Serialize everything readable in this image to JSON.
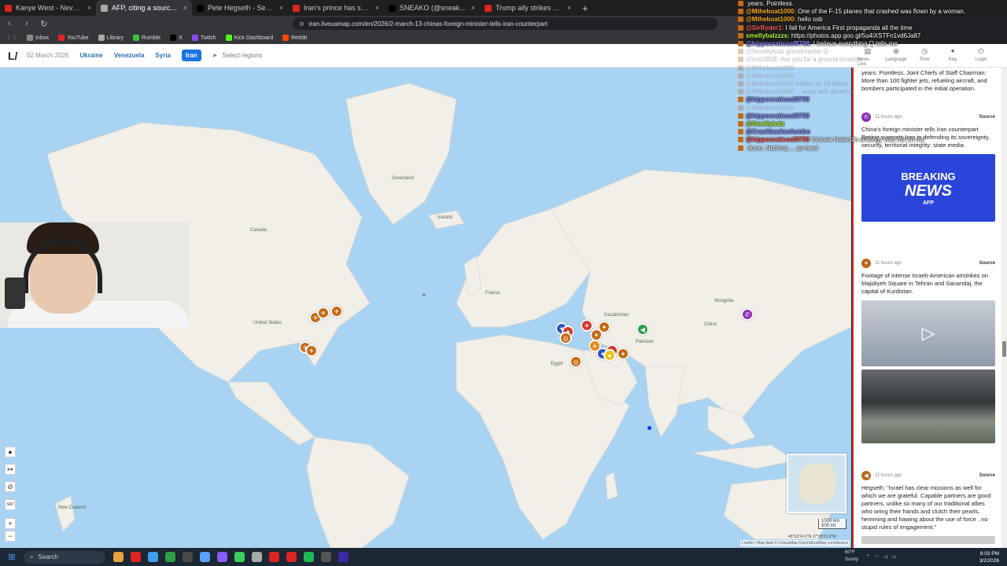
{
  "browser": {
    "tabs": [
      {
        "title": "Kanye West - Never See Me Again -",
        "color": "#e02424",
        "active": false
      },
      {
        "title": "AFP, citing a source: Saudi Arabi",
        "color": "#aaaaaa",
        "active": true
      },
      {
        "title": "Pete Hegseth - Search / X",
        "color": "#000000",
        "active": false
      },
      {
        "title": "Iran's prince has something to say...",
        "color": "#e02424",
        "active": false
      },
      {
        "title": "SNEAKO (@sneako) / X",
        "color": "#000000",
        "active": false
      },
      {
        "title": "Trump ally strikes Alaska gas deal wit",
        "color": "#e02424",
        "active": false
      }
    ],
    "url": "iran.liveuamap.com/en/2026/2-march-13-chinas-foreign-minister-tells-iran-counterpart",
    "bookmarks": [
      {
        "label": "Inbox",
        "color": "#888888"
      },
      {
        "label": "YouTube",
        "color": "#e02424"
      },
      {
        "label": "Library",
        "color": "#aaaaaa"
      },
      {
        "label": "Rumble",
        "color": "#3fbf3f"
      },
      {
        "label": "X",
        "color": "#000000"
      },
      {
        "label": "Twitch",
        "color": "#9146ff"
      },
      {
        "label": "Kick Dashboard",
        "color": "#53fc18"
      },
      {
        "label": "Reddit",
        "color": "#ff4500"
      }
    ]
  },
  "site": {
    "logo": "L/",
    "date": "02 March 2026",
    "regions": [
      "Ukraine",
      "Venezuela",
      "Syria",
      "Iran"
    ],
    "active_region": "Iran",
    "select_regions": "Select regions",
    "nav": [
      {
        "icon": "news-icon",
        "glyph": "▤",
        "label": "News Live"
      },
      {
        "icon": "language-icon",
        "glyph": "⊕",
        "label": "Language"
      },
      {
        "icon": "time-icon",
        "glyph": "◷",
        "label": "Time"
      },
      {
        "icon": "key-icon",
        "glyph": "✦",
        "label": "Key"
      },
      {
        "icon": "login-icon",
        "glyph": "⏻",
        "label": "Login"
      }
    ]
  },
  "map": {
    "labels": [
      "Greenland",
      "Iceland",
      "Canada",
      "United States",
      "France",
      "Kazakhstan",
      "Mongolia",
      "China",
      "Egypt",
      "Pakistan",
      "New Zealand"
    ],
    "scale_km": "1000 km",
    "scale_mi": "500 mi",
    "coords": "45°53'24.0\"N 27°35'51.6\"W",
    "attribution": "Leaflet | Map data © LiveuaMap OpenStreetMap contributors"
  },
  "news": {
    "items": [
      {
        "time": "",
        "text": "years. Pointless. Joint Chiefs of Staff Chairman: More than 100 fighter jets, refueling aircraft, and bombers participated in the initial operation.",
        "source": ""
      },
      {
        "time": "11 hours ago",
        "text": "China's foreign minister tells Iran counterpart Beijing supports Iran in defending its sovereignty, security, territorial integrity: state media",
        "source": "Source",
        "image": "BREAKING NEWS AFP"
      },
      {
        "time": "11 hours ago",
        "text": "Footage of intense Israeli-American airstrikes on Majidiyeh Square in Tehran and Sanandaj, the capital of Kurdistan.",
        "source": "Source"
      },
      {
        "time": "11 hours ago",
        "text": "Hegseth: \"Israel has clear missions as well for which we are grateful. Capable partners are good partners, unlike so many of our traditional allies who wring their hands and clutch their pearls, hemming and hawing about the use of force . no stupid rules of engagement.\"",
        "source": "Source"
      }
    ],
    "breaking": {
      "line1": "BREAKING",
      "line2": "NEWS",
      "line3": "AFP"
    }
  },
  "chat": [
    {
      "user": "",
      "msg": "years. Pointless.",
      "color": "#ffffff",
      "dim": false
    },
    {
      "user": "@Mtheboat1000:",
      "msg": "One of the F-15 planes that crashed was flown by a woman.",
      "color": "#ffb020",
      "dim": false
    },
    {
      "user": "@Mtheboat1000:",
      "msg": "hello ssb",
      "color": "#ffb020",
      "dim": false
    },
    {
      "user": "@SirRyder1:",
      "msg": "I fall for America First propaganda all the time",
      "color": "#ff6060",
      "dim": false
    },
    {
      "user": "smellybalzzzs:",
      "msg": "https://photos.app.goo.gl/5u4iXSTFn1vd6Ja87",
      "color": "#b8ff3a",
      "dim": false
    },
    {
      "user": "@hippocraticoaf8798:",
      "msg": "I believe everything Q tells me",
      "color": "#8a8aff",
      "dim": false
    },
    {
      "user": "@Smellybalz",
      "msg": "grandmaster Q",
      "color": "#b8ff3a",
      "dim": true
    },
    {
      "user": "@ssb3838:",
      "msg": "Are you for a ground invasion",
      "color": "#b8ff3a",
      "dim": true
    },
    {
      "user": "@Mtheboat1000",
      "msg": "",
      "color": "#ffb020",
      "dim": true
    },
    {
      "user": "@Mtheboat1000",
      "msg": "",
      "color": "#ffb020",
      "dim": true
    },
    {
      "user": "",
      "msg": "",
      "color": "#ffffff",
      "dim": true
    },
    {
      "user": "@Mtheboat1000",
      "msg": "million vs 18 billion",
      "color": "#ffb020",
      "dim": true
    },
    {
      "user": "",
      "msg": "",
      "color": "#ffffff",
      "dim": true
    },
    {
      "user": "@Mtheboat1000",
      "msg": "... wars with america",
      "color": "#ffb020",
      "dim": true
    },
    {
      "user": "@hippocraticoaf8798",
      "msg": "",
      "color": "#8a8aff",
      "dim": false
    },
    {
      "user": "@Mtheboat1000",
      "msg": "",
      "color": "#ffb020",
      "dim": true
    },
    {
      "user": "",
      "msg": "",
      "color": "#ffffff",
      "dim": true
    },
    {
      "user": "@hippocraticoaf8798",
      "msg": "",
      "color": "#8a8aff",
      "dim": false
    },
    {
      "user": "",
      "msg": "",
      "color": "#ffffff",
      "dim": true
    },
    {
      "user": "@Smellybalz",
      "msg": "",
      "color": "#b8ff3a",
      "dim": false
    },
    {
      "user": "@Crackbackcolumbo",
      "msg": "",
      "color": "#8a8aff",
      "dim": false
    },
    {
      "user": "@hippocraticoaf8798",
      "msg": "Victoria Nuland's strategy was not on my",
      "color": "#ff6060",
      "dim": false
    },
    {
      "user": "",
      "msg": "down. Nothing ... go hard",
      "color": "#ffffff",
      "dim": false
    },
    {
      "user": "",
      "msg": "",
      "color": "#ffffff",
      "dim": true
    },
    {
      "user": "",
      "msg": "",
      "color": "#ffffff",
      "dim": true
    }
  ],
  "taskbar": {
    "search": "Search",
    "weather_temp": "60°F",
    "weather_desc": "Sunny",
    "time": "8:03 PM",
    "date": "3/2/2026",
    "apps": [
      "#e8a33c",
      "#e02424",
      "#3ea0e8",
      "#2e9e44",
      "#4a4a4a",
      "#5aa0ff",
      "#8a5cff",
      "#3ccf5a",
      "#aaaaaa",
      "#e02424",
      "#e02424",
      "#1db954",
      "#555555",
      "#3b2aa8"
    ]
  },
  "colors": {
    "ocean": "#a9d3f3",
    "land": "#f1efe8",
    "accent": "#1b74e4",
    "panel_border": "#d62a2a"
  }
}
